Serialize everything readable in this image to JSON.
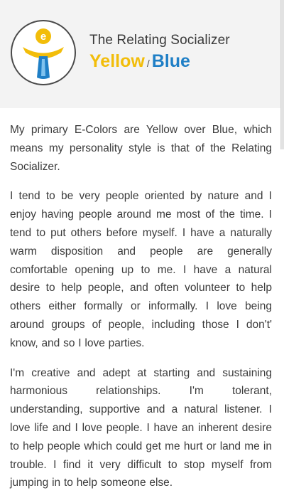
{
  "header": {
    "subtitle": "The Relating Socializer",
    "primary_color": "Yellow",
    "separator": "/",
    "secondary_color": "Blue",
    "logo_letter": "e",
    "logo_icon": "ecolors-logo-icon"
  },
  "colors": {
    "header_background": "#f3f3f3",
    "primary": "#f2bd0a",
    "secondary": "#1f7fc6",
    "text": "#3b3b3b"
  },
  "paragraphs": [
    "My primary E-Colors are Yellow over Blue, which means my personality style is that of the Relating Socializer.",
    "I tend to be very people oriented by nature and I enjoy having people around me most of the time. I tend to put others before myself. I have a naturally warm disposition and people are generally comfortable opening up to me. I have a natural desire to help people, and often volunteer to help others either formally or informally. I love being around groups of people, including those I don't' know, and so I love parties.",
    "I'm creative and adept at starting and sustaining harmonious relationships. I'm tolerant, understanding, supportive and a natural listener. I love life and I love people. I have an inherent desire to help people which could get me hurt or land me in trouble. I find it very difficult to stop myself from jumping in to help someone else."
  ]
}
